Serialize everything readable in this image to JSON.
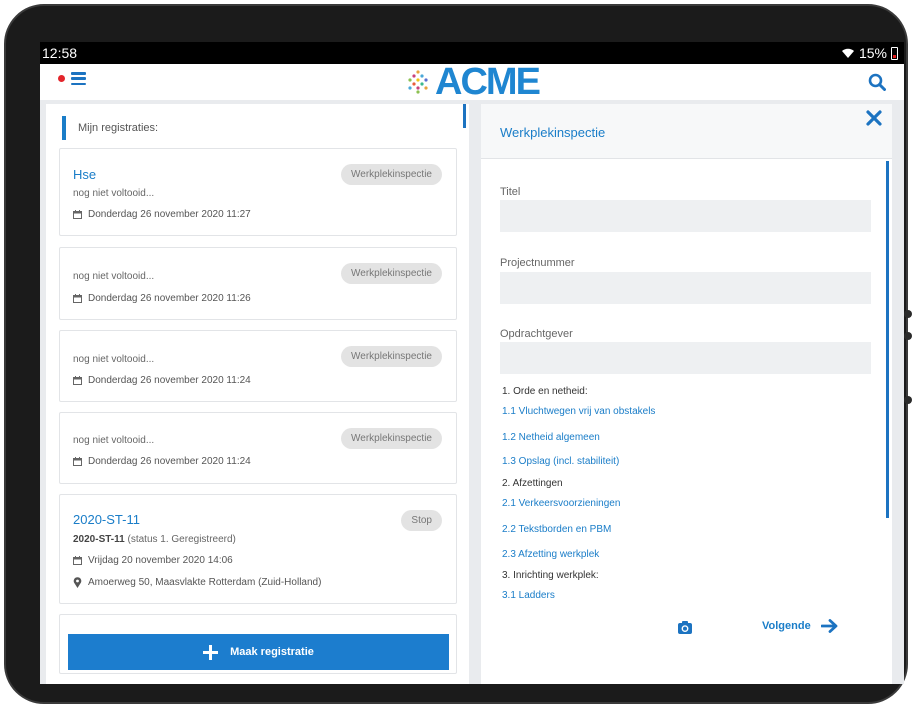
{
  "status_bar": {
    "time": "12:58",
    "battery": "15%"
  },
  "app": {
    "logo_text": "ACME"
  },
  "registrations": {
    "header": "Mijn registraties:",
    "items": [
      {
        "title": "Hse",
        "badge": "Werkplekinspectie",
        "status": "nog niet voltooid...",
        "date": "Donderdag 26 november 2020 11:27"
      },
      {
        "title": "",
        "badge": "Werkplekinspectie",
        "status": "nog niet voltooid...",
        "date": "Donderdag 26 november 2020 11:26"
      },
      {
        "title": "",
        "badge": "Werkplekinspectie",
        "status": "nog niet voltooid...",
        "date": "Donderdag 26 november 2020 11:24"
      },
      {
        "title": "",
        "badge": "Werkplekinspectie",
        "status": "nog niet voltooid...",
        "date": "Donderdag 26 november 2020 11:24"
      },
      {
        "title": "2020-ST-11",
        "badge": "Stop",
        "status_bold": "2020-ST-11",
        "status": "(status 1. Geregistreerd)",
        "date": "Vrijdag 20 november 2020 14:06",
        "address": "Amoerweg 50, Maasvlakte Rotterdam (Zuid-Holland)"
      }
    ],
    "create_button": "Maak registratie"
  },
  "form": {
    "title": "Werkplekinspectie",
    "fields": [
      {
        "label": "Titel",
        "value": ""
      },
      {
        "label": "Projectnummer",
        "value": ""
      },
      {
        "label": "Opdrachtgever",
        "value": ""
      }
    ],
    "sections": [
      {
        "heading": "1. Orde en netheid:",
        "links": [
          "1.1 Vluchtwegen vrij van obstakels",
          "1.2 Netheid algemeen",
          "1.3 Opslag (incl. stabiliteit)"
        ]
      },
      {
        "heading": "2. Afzettingen",
        "links": [
          "2.1 Verkeersvoorzieningen",
          "2.2 Tekstborden en PBM",
          "2.3 Afzetting werkplek"
        ]
      },
      {
        "heading": "3. Inrichting werkplek:",
        "links": [
          "3.1 Ladders"
        ]
      }
    ],
    "next_label": "Volgende"
  },
  "icons": {
    "menu": "hamburger-icon",
    "search": "search-icon",
    "close": "close-icon",
    "calendar": "calendar-icon",
    "location": "map-pin-icon",
    "camera": "camera-icon",
    "next": "arrow-right-icon",
    "add": "plus-icon"
  },
  "colors": {
    "accent": "#1c7dce",
    "notification": "#e3252b",
    "badge_bg": "#e3e3e3"
  }
}
